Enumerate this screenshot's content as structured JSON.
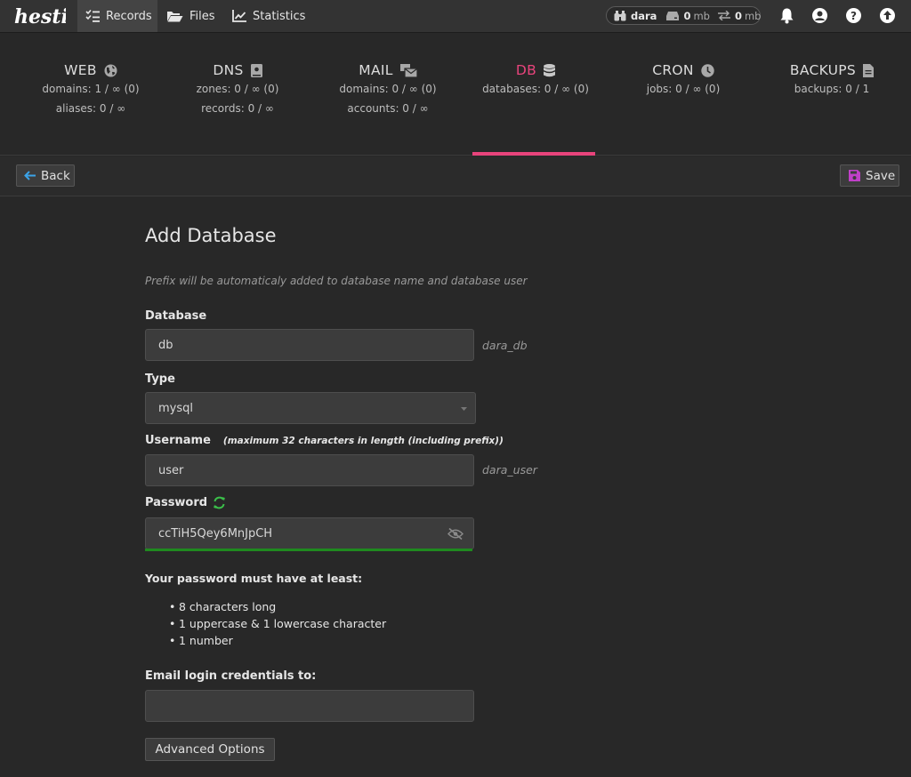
{
  "app": {
    "logo_text": "hestia"
  },
  "nav": {
    "records": "Records",
    "files": "Files",
    "statistics": "Statistics"
  },
  "user": {
    "name": "dara",
    "disk_value": "0",
    "disk_unit": "mb",
    "bw_value": "0",
    "bw_unit": "mb"
  },
  "stats": [
    {
      "title": "WEB",
      "icon": "globe-icon",
      "lines": [
        "domains: 1 / ∞ (0)",
        "aliases: 0 / ∞"
      ]
    },
    {
      "title": "DNS",
      "icon": "book-icon",
      "lines": [
        "zones: 0 / ∞ (0)",
        "records: 0 / ∞"
      ]
    },
    {
      "title": "MAIL",
      "icon": "mail-bulk-icon",
      "lines": [
        "domains: 0 / ∞ (0)",
        "accounts: 0 / ∞"
      ]
    },
    {
      "title": "DB",
      "icon": "database-icon",
      "lines": [
        "databases: 0 / ∞ (0)"
      ]
    },
    {
      "title": "CRON",
      "icon": "clock-icon",
      "lines": [
        "jobs: 0 / ∞ (0)"
      ]
    },
    {
      "title": "BACKUPS",
      "icon": "file-icon",
      "lines": [
        "backups: 0 / 1"
      ]
    }
  ],
  "toolbar": {
    "back": "Back",
    "save": "Save"
  },
  "form": {
    "title": "Add Database",
    "hint": "Prefix will be automaticaly added to database name and database user",
    "database_label": "Database",
    "database_value": "db",
    "database_suffix": "dara_db",
    "type_label": "Type",
    "type_value": "mysql",
    "username_label": "Username",
    "username_note": "(maximum 32 characters in length (including prefix))",
    "username_value": "user",
    "username_suffix": "dara_user",
    "password_label": "Password",
    "password_value": "ccTiH5Qey6MnJpCH",
    "requirements_title": "Your password must have at least:",
    "requirements": [
      "8 characters long",
      "1 uppercase & 1 lowercase character",
      "1 number"
    ],
    "email_label": "Email login credentials to:",
    "email_value": "",
    "advanced": "Advanced Options"
  },
  "colors": {
    "accent": "#e8447c",
    "strength": "#1f8a1f",
    "refresh": "#3bbf4a",
    "save_icon": "#c040c8",
    "back_icon": "#3ba3e8"
  }
}
